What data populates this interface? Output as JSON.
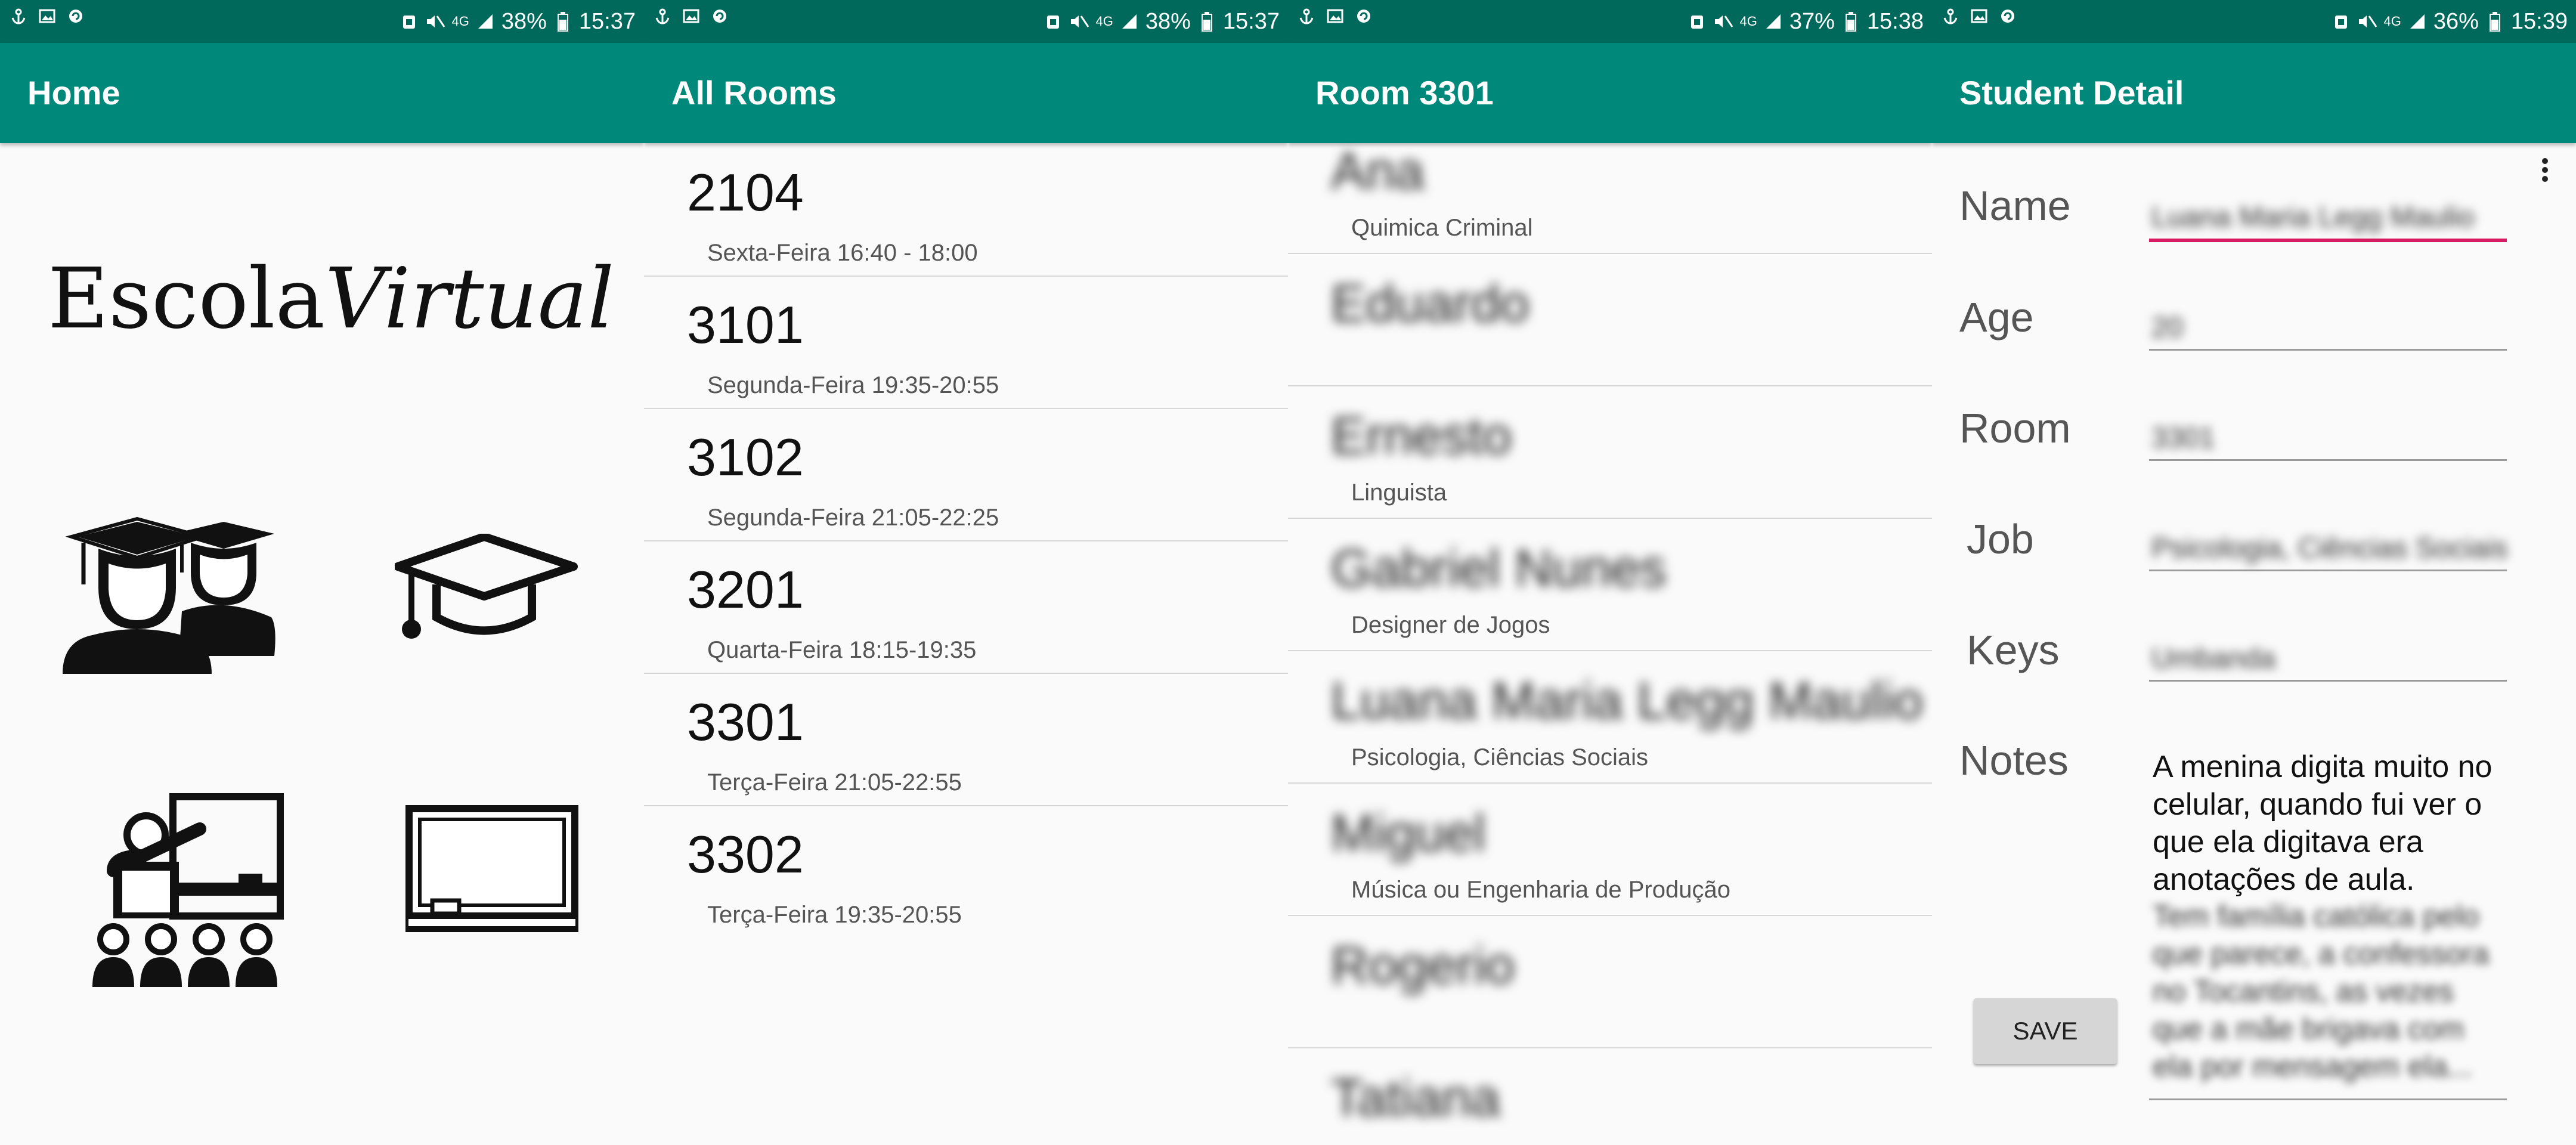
{
  "screens": [
    {
      "status": {
        "battery": "38%",
        "time": "15:37",
        "network": "4G"
      },
      "title": "Home",
      "logo": {
        "part1": "Escola",
        "part2": "Virtual"
      },
      "icons": [
        "students-icon",
        "graduation-cap-icon",
        "classroom-icon",
        "blackboard-icon"
      ]
    },
    {
      "status": {
        "battery": "38%",
        "time": "15:37",
        "network": "4G"
      },
      "title": "All Rooms",
      "rooms": [
        {
          "number": "2104",
          "time": "Sexta-Feira 16:40 - 18:00"
        },
        {
          "number": "3101",
          "time": "Segunda-Feira 19:35-20:55"
        },
        {
          "number": "3102",
          "time": "Segunda-Feira 21:05-22:25"
        },
        {
          "number": "3201",
          "time": "Quarta-Feira 18:15-19:35"
        },
        {
          "number": "3301",
          "time": "Terça-Feira 21:05-22:55"
        },
        {
          "number": "3302",
          "time": "Terça-Feira 19:35-20:55"
        }
      ]
    },
    {
      "status": {
        "battery": "37%",
        "time": "15:38",
        "network": "4G"
      },
      "title": "Room 3301",
      "students": [
        {
          "name": "Ana",
          "job": "Quimica Criminal"
        },
        {
          "name": "Eduardo",
          "job": ""
        },
        {
          "name": "Ernesto",
          "job": "Linguista"
        },
        {
          "name": "Gabriel Nunes",
          "job": "Designer de Jogos"
        },
        {
          "name": "Luana Maria Legg Maulio",
          "job": "Psicologia, Ciências Sociais"
        },
        {
          "name": "Miguel",
          "job": "Música ou Engenharia de Produção"
        },
        {
          "name": "Rogerio",
          "job": ""
        },
        {
          "name": "Tatiana",
          "job": ""
        }
      ]
    },
    {
      "status": {
        "battery": "36%",
        "time": "15:39",
        "network": "4G"
      },
      "title": "Student Detail",
      "labels": {
        "name": "Name",
        "age": "Age",
        "room": "Room",
        "job": "Job",
        "keys": "Keys",
        "notes": "Notes"
      },
      "values": {
        "name": "Luana Maria Legg Maulio",
        "age": "20",
        "room": "3301",
        "job": "Psicologia, Ciências Sociais",
        "keys": "Umbanda"
      },
      "notes_visible": "A menina digita muito no celular, quando fui ver o que ela digitava era anotações de aula.",
      "notes_hidden": "Tem família católica pelo que parece, a confessora no Tocantins, as vezes que a mãe brigava com ela por mensagem ela...",
      "save_label": "SAVE"
    }
  ]
}
